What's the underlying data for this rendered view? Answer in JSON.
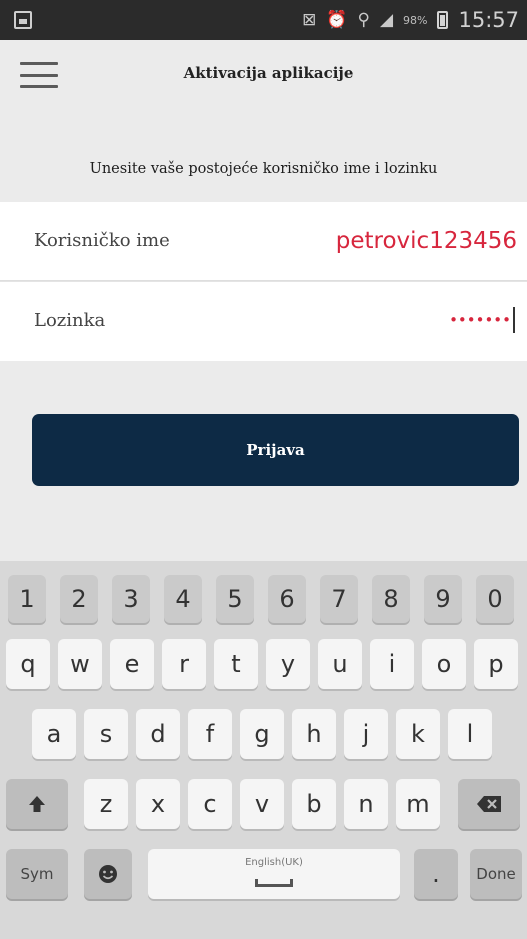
{
  "status_bar": {
    "battery_percent": "98%",
    "time": "15:57",
    "icons": [
      "gallery-icon",
      "no-sim-icon",
      "alarm-icon",
      "wifi-icon",
      "signal-icon",
      "battery-icon"
    ]
  },
  "app_bar": {
    "title": "Aktivacija aplikacije",
    "menu_icon": "hamburger-menu-icon"
  },
  "instruction": "Unesite vaše postojeće korisničko ime i lozinku",
  "form": {
    "username": {
      "label": "Korisničko ime",
      "value": "petrovic123456"
    },
    "password": {
      "label": "Lozinka",
      "masked_value": "•••••••"
    }
  },
  "login_button": "Prijava",
  "keyboard": {
    "number_row": [
      "1",
      "2",
      "3",
      "4",
      "5",
      "6",
      "7",
      "8",
      "9",
      "0"
    ],
    "row1": [
      "q",
      "w",
      "e",
      "r",
      "t",
      "y",
      "u",
      "i",
      "o",
      "p"
    ],
    "row2": [
      "a",
      "s",
      "d",
      "f",
      "g",
      "h",
      "j",
      "k",
      "l"
    ],
    "row3": [
      "z",
      "x",
      "c",
      "v",
      "b",
      "n",
      "m"
    ],
    "sym_label": "Sym",
    "space_label": "English(UK)",
    "done_label": "Done",
    "period_label": ".",
    "shift_icon": "shift-icon",
    "backspace_icon": "backspace-icon",
    "emoji_icon": "emoji-icon"
  },
  "colors": {
    "primary_button": "#0d2a45",
    "input_text": "#d7263d",
    "status_bar": "#2b2b2b"
  }
}
